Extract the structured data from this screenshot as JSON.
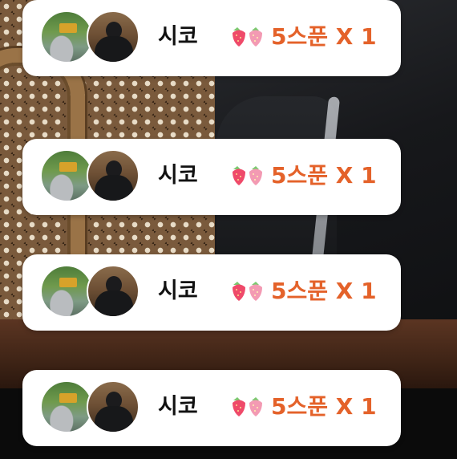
{
  "notifications": [
    {
      "user_name": "시코",
      "reward_label": "5스푼 X 1"
    },
    {
      "user_name": "시코",
      "reward_label": "5스푼 X 1"
    },
    {
      "user_name": "시코",
      "reward_label": "5스푼 X 1"
    },
    {
      "user_name": "시코",
      "reward_label": "5스푼 X 1"
    }
  ],
  "colors": {
    "card_background": "#ffffff",
    "name_text": "#111111",
    "reward_text": "#e4622a",
    "strawberry_red": "#ef4a6a",
    "strawberry_pink": "#f39ab3"
  },
  "icons": [
    "pizza-shop-avatar-icon",
    "person-avatar-icon",
    "strawberry-pair-icon"
  ]
}
